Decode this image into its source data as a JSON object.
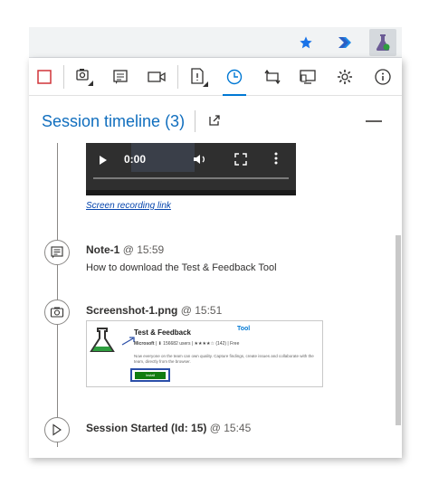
{
  "browser": {
    "icons": [
      "star-icon",
      "azure-devops-arrow-icon",
      "test-feedback-flask-icon"
    ]
  },
  "toolbar": {
    "icons": [
      "stop-recording-icon",
      "capture-screenshot-icon",
      "capture-note-icon",
      "record-screen-icon",
      "create-bug-icon",
      "timeline-icon",
      "connection-icon",
      "device-icon",
      "settings-icon",
      "info-icon"
    ]
  },
  "timeline": {
    "title": "Session timeline (3)"
  },
  "video": {
    "time": "0:00"
  },
  "recording_link": "Screen recording link",
  "entries": [
    {
      "name": "Note-1",
      "at": "@ 15:59",
      "description": "How to download the Test & Feedback Tool"
    },
    {
      "name": "Screenshot-1.png",
      "at": "@ 15:51"
    },
    {
      "name": "Session Started (Id: 15)",
      "at": "@ 15:45"
    }
  ],
  "screenshot": {
    "title": "Test & Feedback",
    "tool_label": "Tool",
    "publisher": "Microsoft",
    "meta": "| ⬇ 156682 users | ★★★★☆ (142) | Free",
    "description": "Now everyone on the team can own quality. Capture findings, create issues and collaborate with the team, directly from the browser.",
    "install_label": "Install"
  },
  "colors": {
    "accent": "#0078d4",
    "title_blue": "#106ebe",
    "stop_red": "#d13438"
  }
}
